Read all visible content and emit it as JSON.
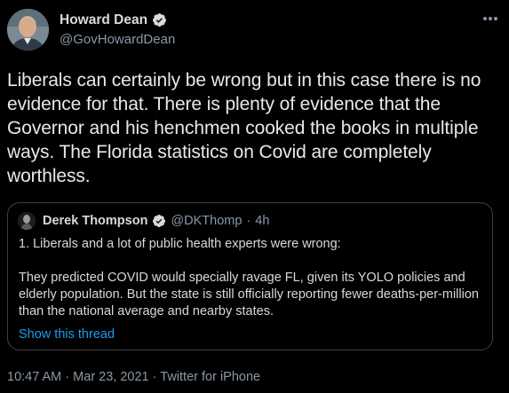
{
  "author": {
    "display_name": "Howard Dean",
    "handle": "@GovHowardDean"
  },
  "tweet": {
    "text": "Liberals can certainly be wrong but in this case there is no evidence for that. There is plenty of evidence that the Governor and his henchmen cooked the books in multiple ways. The Florida statistics on Covid are completely worthless."
  },
  "quoted_tweet": {
    "display_name": "Derek Thompson",
    "handle": "@DKThomp",
    "separator": "·",
    "time": "4h",
    "paragraph_1": "1. Liberals and a lot of public health experts were wrong:",
    "paragraph_2": "They predicted COVID would specially ravage FL, given its YOLO policies and elderly population. But the state is still officially reporting fewer deaths-per-million than the national average and nearby states.",
    "show_thread_label": "Show this thread"
  },
  "meta": {
    "time": "10:47 AM",
    "separator_1": "·",
    "date": "Mar 23, 2021",
    "separator_2": "·",
    "source": "Twitter for iPhone"
  },
  "icons": {
    "verified": "verified-badge-icon",
    "more": "more-icon"
  },
  "colors": {
    "background": "#000000",
    "text_primary": "#e8e8e8",
    "text_secondary": "#8b98a5",
    "link": "#1d9bf0",
    "border": "#3c4043"
  }
}
